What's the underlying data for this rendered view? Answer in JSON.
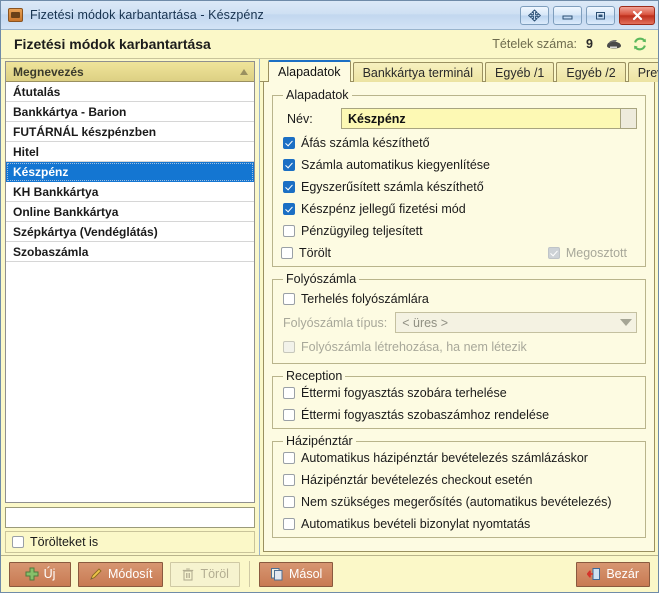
{
  "window": {
    "title": "Fizetési módok karbantartása - Készpénz",
    "app_icon": "app-icon",
    "buttons": {
      "move": "move-resize-icon",
      "minimize": "minimize-icon",
      "maximize": "maximize-icon",
      "close": "close-icon"
    }
  },
  "header": {
    "title": "Fizetési módok karbantartása",
    "items_label": "Tételek száma:",
    "items_count": "9",
    "print_icon": "printer-icon",
    "refresh_icon": "refresh-icon"
  },
  "list": {
    "column_header": "Megnevezés",
    "sort": "ascending",
    "rows": [
      {
        "label": "Átutalás",
        "selected": false
      },
      {
        "label": "Bankkártya - Barion",
        "selected": false
      },
      {
        "label": "FUTÁRNÁL készpénzben",
        "selected": false
      },
      {
        "label": "Hitel",
        "selected": false
      },
      {
        "label": "Készpénz",
        "selected": true
      },
      {
        "label": "KH Bankkártya",
        "selected": false
      },
      {
        "label": "Online Bankkártya",
        "selected": false
      },
      {
        "label": "Szépkártya (Vendéglátás)",
        "selected": false
      },
      {
        "label": "Szobaszámla",
        "selected": false
      }
    ],
    "search_value": "",
    "search_placeholder": "",
    "show_deleted_label": "Törölteket is",
    "show_deleted_checked": false
  },
  "tabs": [
    {
      "label": "Alapadatok",
      "active": true
    },
    {
      "label": "Bankkártya terminál",
      "active": false
    },
    {
      "label": "Egyéb /1",
      "active": false
    },
    {
      "label": "Egyéb /2",
      "active": false
    },
    {
      "label": "Previo",
      "active": false
    }
  ],
  "groups": {
    "alapadatok": {
      "legend": "Alapadatok",
      "name_label": "Név:",
      "name_value": "Készpénz",
      "checks": [
        {
          "label": "Áfás számla készíthető",
          "checked": true,
          "disabled": false
        },
        {
          "label": "Számla automatikus kiegyenlítése",
          "checked": true,
          "disabled": false
        },
        {
          "label": "Egyszerűsített számla készíthető",
          "checked": true,
          "disabled": false
        },
        {
          "label": "Készpénz jellegű fizetési mód",
          "checked": true,
          "disabled": false
        },
        {
          "label": "Pénzügyileg teljesített",
          "checked": false,
          "disabled": false
        }
      ],
      "deleted_label": "Törölt",
      "deleted_checked": false,
      "shared_label": "Megosztott",
      "shared_checked": true,
      "shared_disabled": true
    },
    "folyoszamla": {
      "legend": "Folyószámla",
      "charge_label": "Terhelés folyószámlára",
      "charge_checked": false,
      "type_label": "Folyószámla típus:",
      "type_value": "< üres >",
      "create_label": "Folyószámla létrehozása, ha nem létezik",
      "create_checked": false,
      "create_disabled": true
    },
    "reception": {
      "legend": "Reception",
      "checks": [
        {
          "label": "Éttermi fogyasztás szobára terhelése",
          "checked": false
        },
        {
          "label": "Éttermi fogyasztás szobaszámhoz rendelése",
          "checked": false
        }
      ]
    },
    "hazipenztar": {
      "legend": "Házipénztár",
      "checks": [
        {
          "label": "Automatikus házipénztár bevételezés számlázáskor",
          "checked": false
        },
        {
          "label": "Házipénztár bevételezés checkout esetén",
          "checked": false
        },
        {
          "label": "Nem szükséges megerősítés (automatikus bevételezés)",
          "checked": false
        },
        {
          "label": "Automatikus bevételi bizonylat nyomtatás",
          "checked": false
        }
      ]
    }
  },
  "footer": {
    "new_label": "Új",
    "modify_label": "Módosít",
    "delete_label": "Töröl",
    "copy_label": "Másol",
    "close_label": "Bezár"
  },
  "colors": {
    "accent_blue": "#1476d2",
    "panel_yellow": "#fbf8c8",
    "content_yellow": "#fdfbe2",
    "button_salmon": "#c87a53",
    "grid_header": "#e3d68e",
    "close_red": "#bd2f1c"
  }
}
